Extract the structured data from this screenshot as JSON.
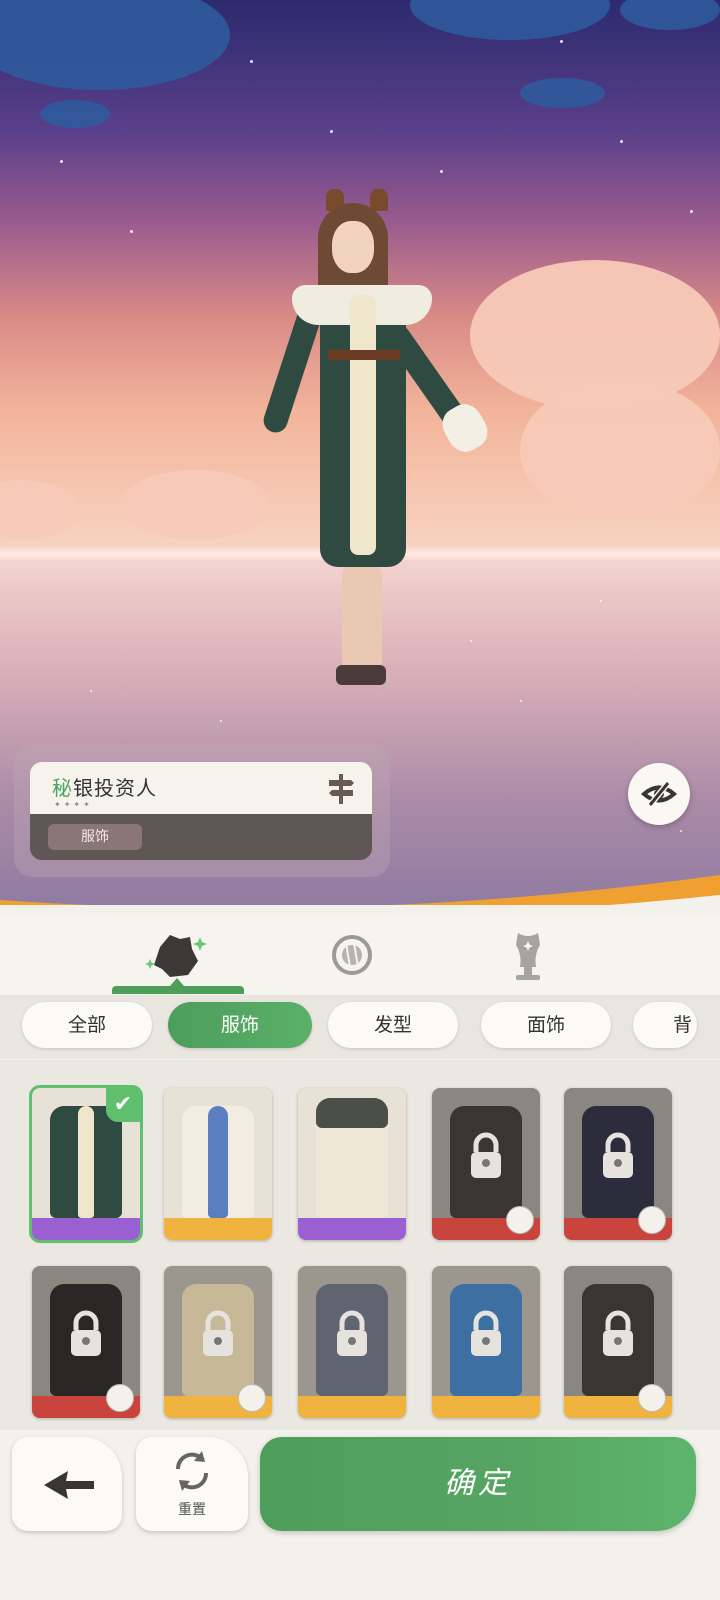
{
  "outfit": {
    "name_first_char": "秘",
    "name_rest": "银投资人",
    "stars": "✦✦✦✦",
    "tag": "服饰"
  },
  "tabs": [
    {
      "name": "tab-clothing",
      "icon": "outfit-stars-icon",
      "active": true
    },
    {
      "name": "tab-accessory",
      "icon": "ring-emblem-icon",
      "active": false
    },
    {
      "name": "tab-mannequin",
      "icon": "mannequin-icon",
      "active": false
    }
  ],
  "filters": [
    "全部",
    "服饰",
    "发型",
    "面饰",
    "背"
  ],
  "active_filter": "服饰",
  "items_row1": [
    {
      "rarity": "purple",
      "locked": false,
      "selected": true,
      "corner": ""
    },
    {
      "rarity": "gold",
      "locked": false,
      "selected": false,
      "corner": ""
    },
    {
      "rarity": "purple",
      "locked": false,
      "selected": false,
      "corner": ""
    },
    {
      "rarity": "red",
      "locked": true,
      "selected": false,
      "corner": "hourglass-icon"
    },
    {
      "rarity": "red",
      "locked": true,
      "selected": false,
      "corner": "hourglass-icon"
    }
  ],
  "items_row2": [
    {
      "rarity": "red",
      "locked": true,
      "selected": false,
      "corner": "hourglass-icon"
    },
    {
      "rarity": "gold",
      "locked": true,
      "selected": false,
      "corner": "paw-icon"
    },
    {
      "rarity": "gold",
      "locked": true,
      "selected": false,
      "corner": ""
    },
    {
      "rarity": "gold",
      "locked": true,
      "selected": false,
      "corner": ""
    },
    {
      "rarity": "gold",
      "locked": true,
      "selected": false,
      "corner": "paw-icon"
    }
  ],
  "buttons": {
    "reset": "重置",
    "confirm": "确定"
  },
  "colors": {
    "accent_green": "#4c9e5a",
    "rarity_purple": "#9a5fd0",
    "rarity_gold": "#f0b340",
    "rarity_red": "#c9443c"
  }
}
